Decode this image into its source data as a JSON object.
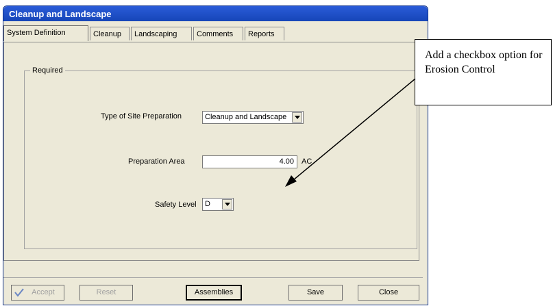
{
  "window": {
    "title": "Cleanup and Landscape"
  },
  "tabs": [
    "System Definition",
    "Cleanup",
    "Landscaping",
    "Comments",
    "Reports"
  ],
  "group": {
    "label": "Required"
  },
  "fields": {
    "site_prep": {
      "label": "Type of Site Preparation",
      "value": "Cleanup and Landscape"
    },
    "area": {
      "label": "Preparation Area",
      "value": "4.00",
      "unit": "AC"
    },
    "safety": {
      "label": "Safety Level",
      "value": "D"
    }
  },
  "buttons": {
    "accept": "Accept",
    "reset": "Reset",
    "assemblies": "Assemblies",
    "save": "Save",
    "close": "Close"
  },
  "callout": {
    "text": "Add a checkbox option for Erosion Control"
  },
  "colors": {
    "title_bar": "#2a5bd8",
    "window_bg": "#ece9d8"
  }
}
